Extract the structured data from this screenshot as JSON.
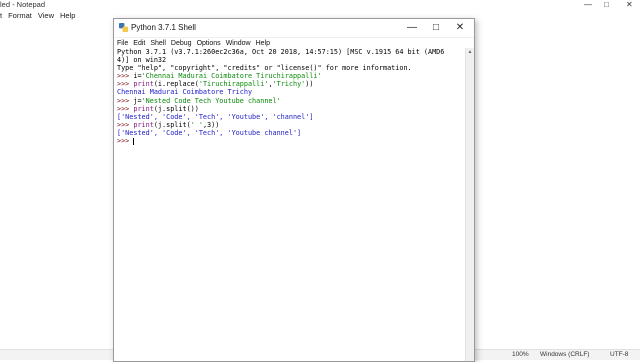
{
  "notepad": {
    "title": "led - Notepad",
    "menu": [
      "t",
      "Format",
      "View",
      "Help"
    ],
    "status": {
      "zoom": "100%",
      "line_ending": "Windows (CRLF)",
      "encoding": "UTF-8"
    }
  },
  "shell": {
    "title": "Python 3.7.1 Shell",
    "menu": [
      "File",
      "Edit",
      "Shell",
      "Debug",
      "Options",
      "Window",
      "Help"
    ],
    "lines": [
      {
        "parts": [
          {
            "t": "Python 3.7.1 (v3.7.1:260ec2c36a, Oct 20 2018, 14:57:15) [MSC v.1915 64 bit (AMD6",
            "c": "black"
          }
        ]
      },
      {
        "parts": [
          {
            "t": "4)] on win32",
            "c": "black"
          }
        ]
      },
      {
        "parts": [
          {
            "t": "Type \"help\", \"copyright\", \"credits\" or \"license()\" for more information.",
            "c": "black"
          }
        ]
      },
      {
        "parts": [
          {
            "t": ">>> ",
            "c": "prompt"
          },
          {
            "t": "i=",
            "c": "black"
          },
          {
            "t": "'Chennai Madurai Coimbatore Tiruchirappalli'",
            "c": "green"
          }
        ]
      },
      {
        "parts": [
          {
            "t": ">>> ",
            "c": "prompt"
          },
          {
            "t": "print",
            "c": "purple"
          },
          {
            "t": "(i.replace(",
            "c": "black"
          },
          {
            "t": "'Tiruchirappalli'",
            "c": "green"
          },
          {
            "t": ",",
            "c": "black"
          },
          {
            "t": "'Trichy'",
            "c": "green"
          },
          {
            "t": "))",
            "c": "black"
          }
        ]
      },
      {
        "parts": [
          {
            "t": "Chennai Madurai Coimbatore Trichy",
            "c": "blue"
          }
        ]
      },
      {
        "parts": [
          {
            "t": ">>> ",
            "c": "prompt"
          },
          {
            "t": "j=",
            "c": "black"
          },
          {
            "t": "'Nested Code Tech Youtube channel'",
            "c": "green"
          }
        ]
      },
      {
        "parts": [
          {
            "t": ">>> ",
            "c": "prompt"
          },
          {
            "t": "print",
            "c": "purple"
          },
          {
            "t": "(j.split())",
            "c": "black"
          }
        ]
      },
      {
        "parts": [
          {
            "t": "['Nested', 'Code', 'Tech', 'Youtube', 'channel']",
            "c": "blue"
          }
        ]
      },
      {
        "parts": [
          {
            "t": ">>> ",
            "c": "prompt"
          },
          {
            "t": "print",
            "c": "purple"
          },
          {
            "t": "(j.split(",
            "c": "black"
          },
          {
            "t": "' '",
            "c": "green"
          },
          {
            "t": ",3))",
            "c": "black"
          }
        ]
      },
      {
        "parts": [
          {
            "t": "['Nested', 'Code', 'Tech', 'Youtube channel']",
            "c": "blue"
          }
        ]
      },
      {
        "parts": [
          {
            "t": ">>> ",
            "c": "prompt"
          }
        ],
        "cursor": true
      }
    ]
  }
}
